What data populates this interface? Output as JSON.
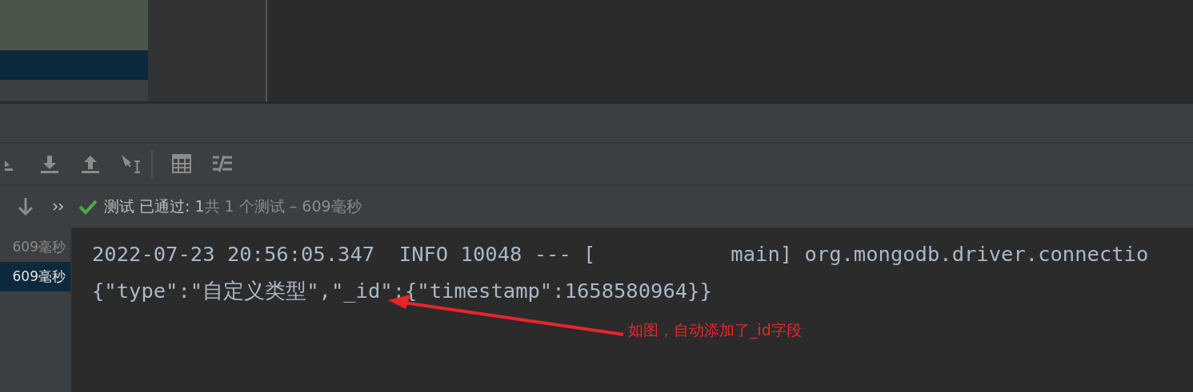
{
  "status": {
    "passed": "测试 已通过: 1",
    "summary": "共 1 个测试 – 609毫秒"
  },
  "test_list": [
    {
      "time": "609毫秒",
      "selected": false
    },
    {
      "time": "609毫秒",
      "selected": true
    }
  ],
  "console": {
    "lines": [
      "2022-07-23 20:56:05.347  INFO 10048 --- [           main] org.mongodb.driver.connectio",
      "{\"type\":\"自定义类型\",\"_id\":{\"timestamp\":1658580964}}"
    ]
  },
  "annotation": {
    "text": "如图，自动添加了_id字段"
  }
}
